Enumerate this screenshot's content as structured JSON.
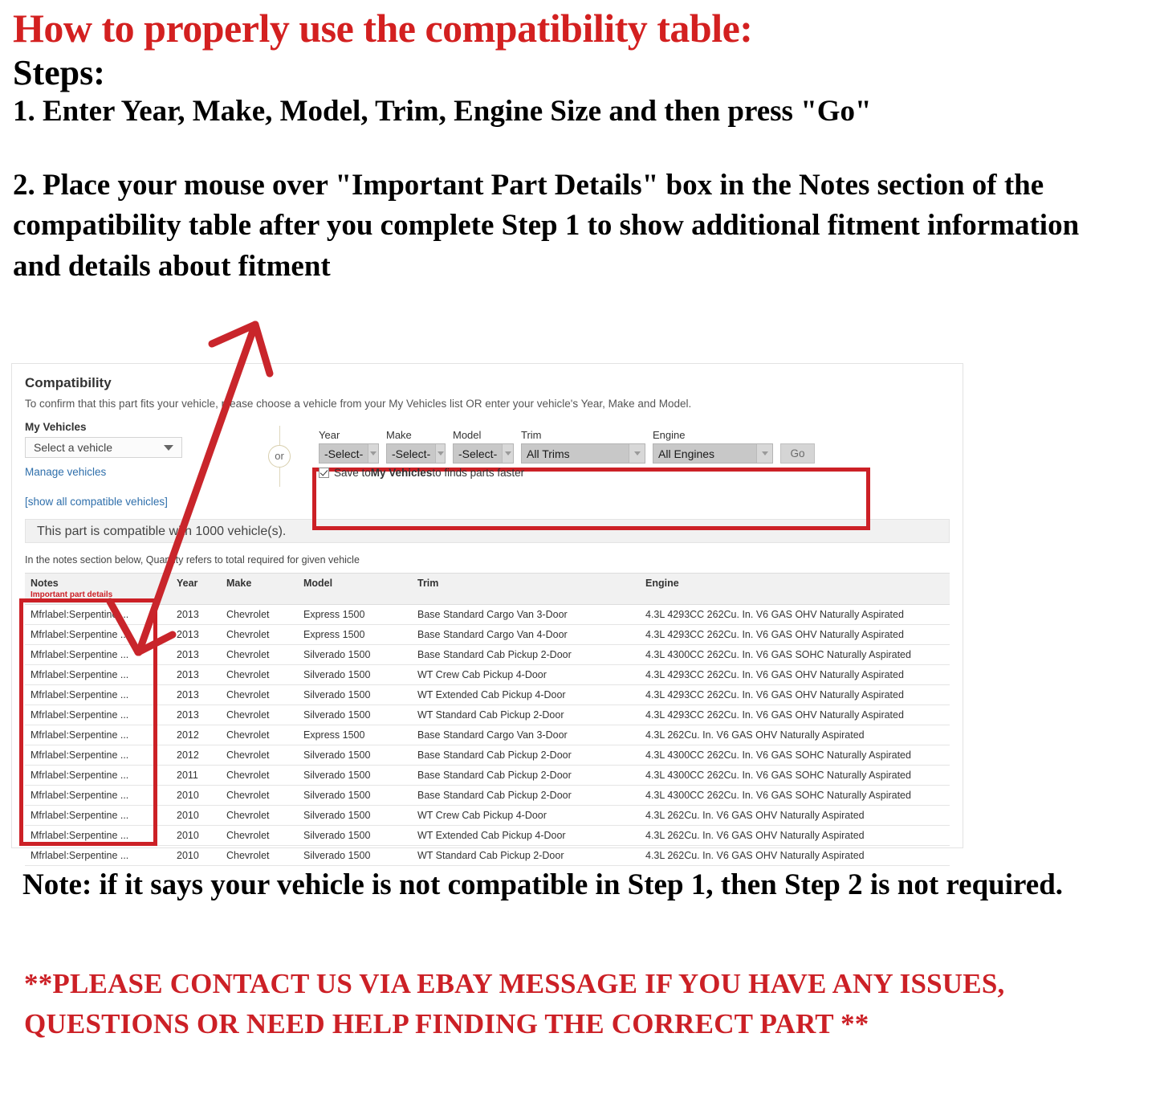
{
  "instructions": {
    "headline": "How to properly use the compatibility table:",
    "steps_label": "Steps:",
    "step1": "1. Enter Year, Make, Model, Trim, Engine Size and then press \"Go\"",
    "step2": "2. Place your mouse over \"Important Part Details\" box in the Notes section of the compatibility table after you complete Step 1 to show additional fitment information and details about fitment"
  },
  "compatibility": {
    "title": "Compatibility",
    "subtitle": "To confirm that this part fits your vehicle, please choose a vehicle from your My Vehicles list OR enter your vehicle's Year, Make and Model.",
    "my_vehicles_label": "My Vehicles",
    "vehicle_select_value": "Select a vehicle",
    "manage_vehicles_link": "Manage vehicles",
    "show_all_link": "[show all compatible vehicles]",
    "or_label": "or",
    "finder": {
      "fields": [
        {
          "label": "Year",
          "value": "-Select-"
        },
        {
          "label": "Make",
          "value": "-Select-"
        },
        {
          "label": "Model",
          "value": "-Select-"
        },
        {
          "label": "Trim",
          "value": "All Trims"
        },
        {
          "label": "Engine",
          "value": "All Engines"
        }
      ],
      "go_label": "Go",
      "save_checkbox_checked": true,
      "save_text_prefix": "Save to ",
      "save_text_bold": "My Vehicles",
      "save_text_suffix": " to finds parts faster"
    },
    "compat_banner": "This part is compatible with 1000 vehicle(s).",
    "quantity_note": "In the notes section below, Quantity refers to total required for given vehicle",
    "table": {
      "headers": [
        "Notes",
        "Year",
        "Make",
        "Model",
        "Trim",
        "Engine"
      ],
      "notes_subheader": "Important part details",
      "rows": [
        [
          "Mfrlabel:Serpentine ...",
          "2013",
          "Chevrolet",
          "Express 1500",
          "Base Standard Cargo Van 3-Door",
          "4.3L 4293CC 262Cu. In. V6 GAS OHV Naturally Aspirated"
        ],
        [
          "Mfrlabel:Serpentine ...",
          "2013",
          "Chevrolet",
          "Express 1500",
          "Base Standard Cargo Van 4-Door",
          "4.3L 4293CC 262Cu. In. V6 GAS OHV Naturally Aspirated"
        ],
        [
          "Mfrlabel:Serpentine ...",
          "2013",
          "Chevrolet",
          "Silverado 1500",
          "Base Standard Cab Pickup 2-Door",
          "4.3L 4300CC 262Cu. In. V6 GAS SOHC Naturally Aspirated"
        ],
        [
          "Mfrlabel:Serpentine ...",
          "2013",
          "Chevrolet",
          "Silverado 1500",
          "WT Crew Cab Pickup 4-Door",
          "4.3L 4293CC 262Cu. In. V6 GAS OHV Naturally Aspirated"
        ],
        [
          "Mfrlabel:Serpentine ...",
          "2013",
          "Chevrolet",
          "Silverado 1500",
          "WT Extended Cab Pickup 4-Door",
          "4.3L 4293CC 262Cu. In. V6 GAS OHV Naturally Aspirated"
        ],
        [
          "Mfrlabel:Serpentine ...",
          "2013",
          "Chevrolet",
          "Silverado 1500",
          "WT Standard Cab Pickup 2-Door",
          "4.3L 4293CC 262Cu. In. V6 GAS OHV Naturally Aspirated"
        ],
        [
          "Mfrlabel:Serpentine ...",
          "2012",
          "Chevrolet",
          "Express 1500",
          "Base Standard Cargo Van 3-Door",
          "4.3L 262Cu. In. V6 GAS OHV Naturally Aspirated"
        ],
        [
          "Mfrlabel:Serpentine ...",
          "2012",
          "Chevrolet",
          "Silverado 1500",
          "Base Standard Cab Pickup 2-Door",
          "4.3L 4300CC 262Cu. In. V6 GAS SOHC Naturally Aspirated"
        ],
        [
          "Mfrlabel:Serpentine ...",
          "2011",
          "Chevrolet",
          "Silverado 1500",
          "Base Standard Cab Pickup 2-Door",
          "4.3L 4300CC 262Cu. In. V6 GAS SOHC Naturally Aspirated"
        ],
        [
          "Mfrlabel:Serpentine ...",
          "2010",
          "Chevrolet",
          "Silverado 1500",
          "Base Standard Cab Pickup 2-Door",
          "4.3L 4300CC 262Cu. In. V6 GAS SOHC Naturally Aspirated"
        ],
        [
          "Mfrlabel:Serpentine ...",
          "2010",
          "Chevrolet",
          "Silverado 1500",
          "WT Crew Cab Pickup 4-Door",
          "4.3L 262Cu. In. V6 GAS OHV Naturally Aspirated"
        ],
        [
          "Mfrlabel:Serpentine ...",
          "2010",
          "Chevrolet",
          "Silverado 1500",
          "WT Extended Cab Pickup 4-Door",
          "4.3L 262Cu. In. V6 GAS OHV Naturally Aspirated"
        ],
        [
          "Mfrlabel:Serpentine ...",
          "2010",
          "Chevrolet",
          "Silverado 1500",
          "WT Standard Cab Pickup 2-Door",
          "4.3L 262Cu. In. V6 GAS OHV Naturally Aspirated"
        ]
      ]
    }
  },
  "footer": {
    "note": "Note: if it says your vehicle is not compatible in Step 1, then Step 2 is not required.",
    "contact": "**PLEASE CONTACT US VIA EBAY MESSAGE IF YOU HAVE ANY ISSUES, QUESTIONS OR NEED HELP FINDING THE CORRECT PART **"
  },
  "colors": {
    "red": "#cc2026",
    "link_blue": "#2f6fab",
    "header_grey": "#f1f1f1"
  }
}
